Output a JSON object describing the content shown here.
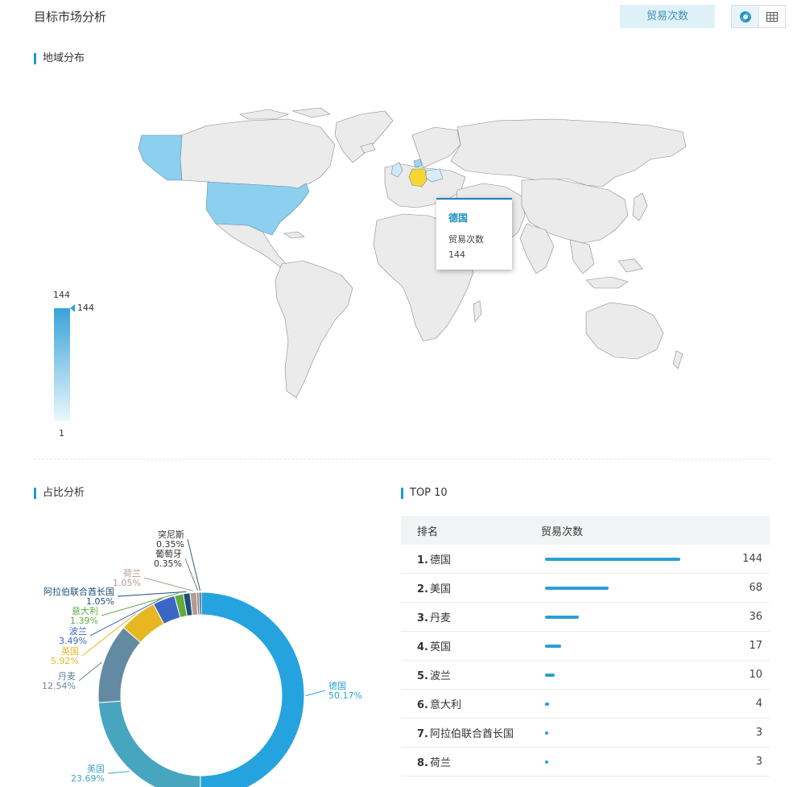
{
  "header": {
    "title": "目标市场分析",
    "metric_button": "贸易次数"
  },
  "colors": {
    "accent": "#1e9bd7",
    "highlight": "#f7d531",
    "map_default": "#ebebeb"
  },
  "map_section": {
    "title": "地域分布",
    "tooltip": {
      "country": "德国",
      "label": "贸易次数",
      "value": "144"
    },
    "legend": {
      "max": "144",
      "min": "1",
      "handle": "144"
    }
  },
  "pie_section": {
    "title": "占比分析",
    "chart_data": {
      "type": "pie",
      "donut": true,
      "slices": [
        {
          "name": "德国",
          "percent": 50.17,
          "label": "50.17%",
          "color": "#25a3de"
        },
        {
          "name": "美国",
          "percent": 23.69,
          "label": "23.69%",
          "color": "#48a5c0"
        },
        {
          "name": "丹麦",
          "percent": 12.54,
          "label": "12.54%",
          "color": "#6489a2"
        },
        {
          "name": "英国",
          "percent": 5.92,
          "label": "5.92%",
          "color": "#e7b722"
        },
        {
          "name": "波兰",
          "percent": 3.49,
          "label": "3.49%",
          "color": "#3c66c4"
        },
        {
          "name": "意大利",
          "percent": 1.39,
          "label": "1.39%",
          "color": "#62ab3e"
        },
        {
          "name": "阿拉伯联合酋长国",
          "percent": 1.05,
          "label": "1.05%",
          "color": "#1d4d7b"
        },
        {
          "name": "荷兰",
          "percent": 1.05,
          "label": "1.05%",
          "color": "#b59a8e"
        },
        {
          "name": "葡萄牙",
          "percent": 0.35,
          "label": "0.35%",
          "color": "#7a7a7a"
        },
        {
          "name": "突尼斯",
          "percent": 0.35,
          "label": "0.35%",
          "color": "#3e5a70"
        }
      ]
    }
  },
  "top_section": {
    "title": "TOP 10",
    "columns": [
      "排名",
      "贸易次数"
    ],
    "rows": [
      {
        "rank": "1.",
        "country": "德国",
        "value": "144",
        "count": 144
      },
      {
        "rank": "2.",
        "country": "美国",
        "value": "68",
        "count": 68
      },
      {
        "rank": "3.",
        "country": "丹麦",
        "value": "36",
        "count": 36
      },
      {
        "rank": "4.",
        "country": "英国",
        "value": "17",
        "count": 17
      },
      {
        "rank": "5.",
        "country": "波兰",
        "value": "10",
        "count": 10
      },
      {
        "rank": "6.",
        "country": "意大利",
        "value": "4",
        "count": 4
      },
      {
        "rank": "7.",
        "country": "阿拉伯联合酋长国",
        "value": "3",
        "count": 3
      },
      {
        "rank": "8.",
        "country": "荷兰",
        "value": "3",
        "count": 3
      }
    ]
  }
}
